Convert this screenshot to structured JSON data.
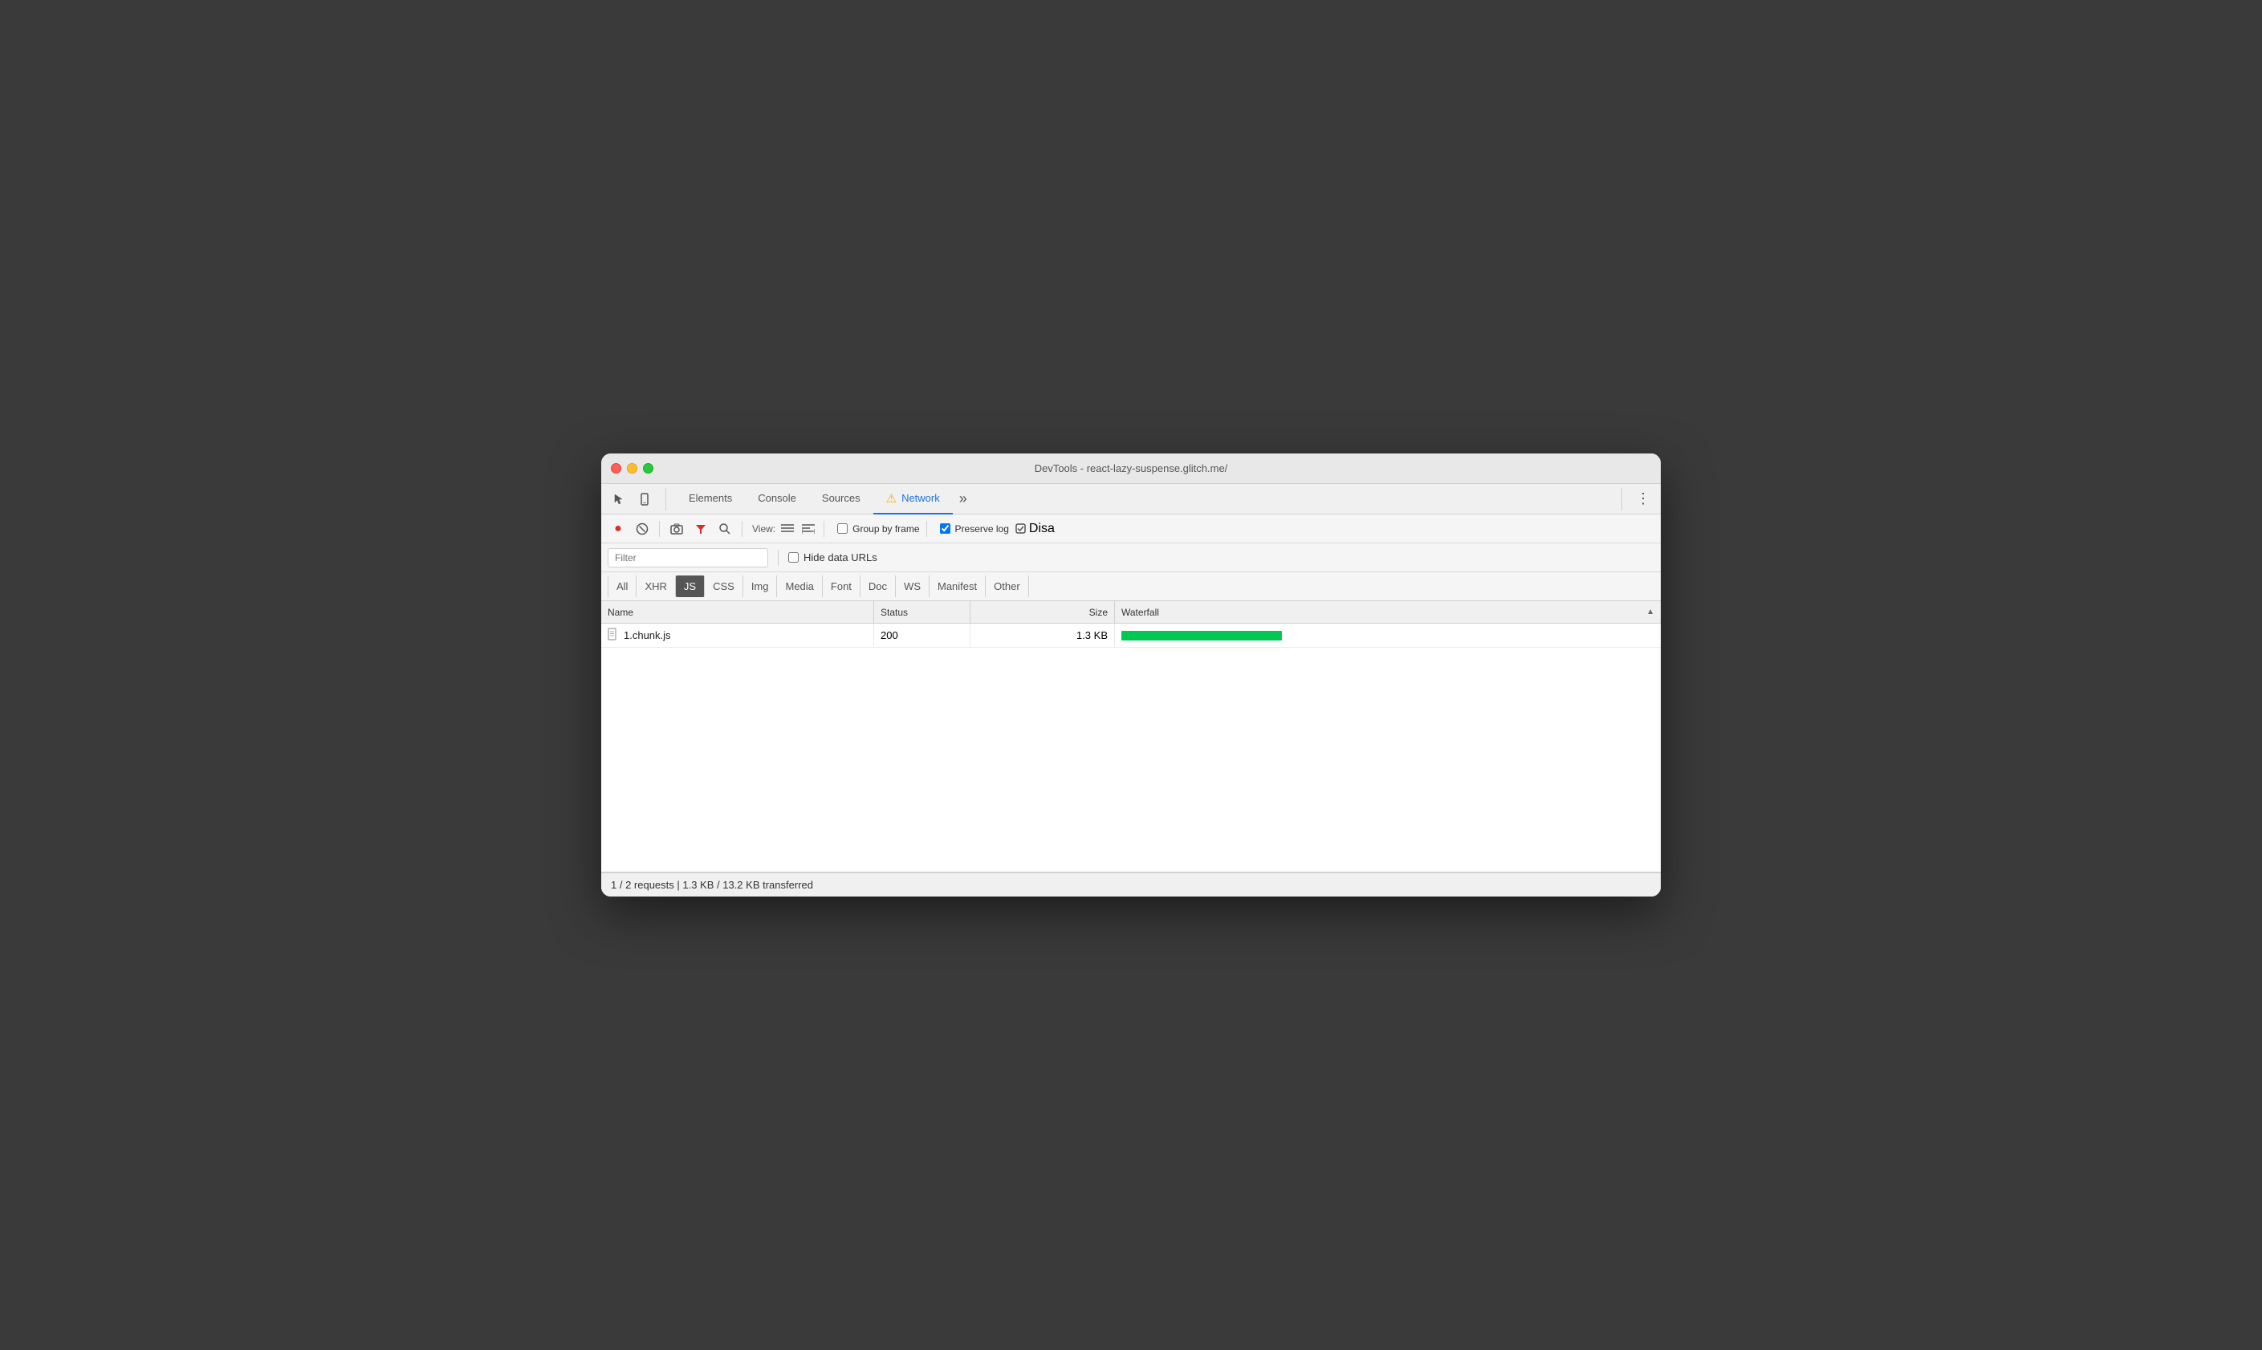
{
  "window": {
    "title": "DevTools - react-lazy-suspense.glitch.me/"
  },
  "tabs": {
    "items": [
      {
        "id": "elements",
        "label": "Elements",
        "active": false
      },
      {
        "id": "console",
        "label": "Console",
        "active": false
      },
      {
        "id": "sources",
        "label": "Sources",
        "active": false
      },
      {
        "id": "network",
        "label": "Network",
        "active": true
      },
      {
        "id": "more",
        "label": "»",
        "active": false
      }
    ]
  },
  "toolbar": {
    "record_title": "Record network log",
    "stop_title": "Stop recording network log",
    "clear_title": "Clear",
    "camera_title": "Capture screenshots",
    "filter_title": "Filter",
    "search_title": "Search",
    "view_label": "View:",
    "list_view_title": "Use large request rows",
    "group_view_title": "Show overview",
    "group_by_frame_label": "Group by frame",
    "preserve_log_label": "Preserve log",
    "disable_cache_label": "Disa",
    "group_by_frame_checked": false,
    "preserve_log_checked": true
  },
  "filter": {
    "placeholder": "Filter",
    "hide_data_urls_label": "Hide data URLs",
    "hide_data_urls_checked": false
  },
  "type_filters": {
    "items": [
      {
        "id": "all",
        "label": "All",
        "active": false
      },
      {
        "id": "xhr",
        "label": "XHR",
        "active": false
      },
      {
        "id": "js",
        "label": "JS",
        "active": true
      },
      {
        "id": "css",
        "label": "CSS",
        "active": false
      },
      {
        "id": "img",
        "label": "Img",
        "active": false
      },
      {
        "id": "media",
        "label": "Media",
        "active": false
      },
      {
        "id": "font",
        "label": "Font",
        "active": false
      },
      {
        "id": "doc",
        "label": "Doc",
        "active": false
      },
      {
        "id": "ws",
        "label": "WS",
        "active": false
      },
      {
        "id": "manifest",
        "label": "Manifest",
        "active": false
      },
      {
        "id": "other",
        "label": "Other",
        "active": false
      }
    ]
  },
  "table": {
    "columns": [
      {
        "id": "name",
        "label": "Name"
      },
      {
        "id": "status",
        "label": "Status"
      },
      {
        "id": "size",
        "label": "Size"
      },
      {
        "id": "waterfall",
        "label": "Waterfall"
      }
    ],
    "rows": [
      {
        "name": "1.chunk.js",
        "status": "200",
        "size": "1.3 KB",
        "waterfall_width": 200,
        "waterfall_color": "#00c853"
      }
    ]
  },
  "status_bar": {
    "text": "1 / 2 requests  |  1.3 KB / 13.2 KB transferred"
  }
}
